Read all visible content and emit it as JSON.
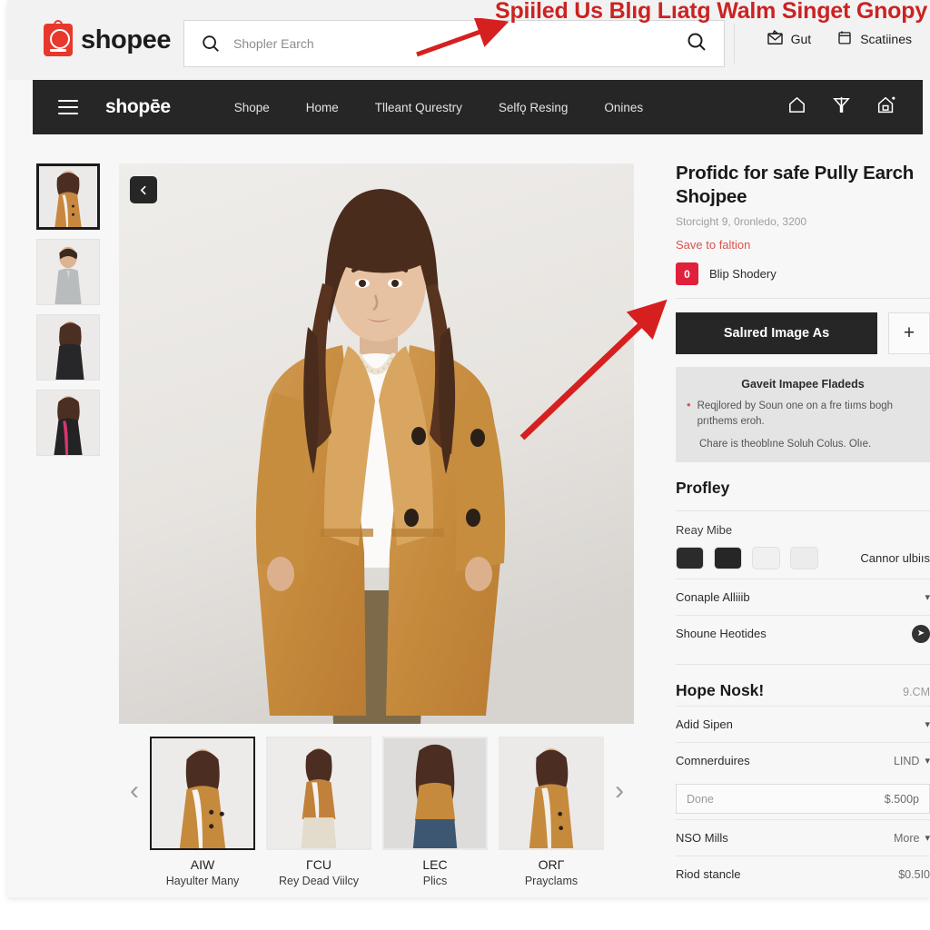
{
  "annotation": {
    "text": "Spiiled Us Blıg Lıatg Walm Singet Gnopy",
    "color": "#cc2222"
  },
  "topbar": {
    "brand": "shopee",
    "search": {
      "placeholder": "Shopler Earch",
      "value": "",
      "left_icon": "search-icon",
      "right_icon": "search-icon"
    },
    "actions": [
      {
        "label": "Gut",
        "icon": "mail-icon"
      },
      {
        "label": "Scatiines",
        "icon": "clipboard-icon"
      }
    ]
  },
  "navbar": {
    "menu_icon": "hamburger-icon",
    "logo": "shopēe",
    "links": [
      "Shope",
      "Home",
      "Tlleant Qurestry",
      "Selfǫ Resing",
      "Onines"
    ],
    "icons": [
      "home-icon",
      "funnel-icon",
      "cart-house-icon"
    ]
  },
  "gallery": {
    "prev_arrow": "chevron-left-icon",
    "thumbs": [
      {
        "alt": "tan blazer front",
        "active": true
      },
      {
        "alt": "grey sweater man",
        "active": false
      },
      {
        "alt": "black top woman",
        "active": false
      },
      {
        "alt": "black jacket pink top",
        "active": false
      }
    ]
  },
  "carousel": {
    "prev": "chevron-left-icon",
    "next": "chevron-right-icon",
    "items": [
      {
        "title": "AIW",
        "subtitle": "Hayulter Many",
        "active": true
      },
      {
        "title": "ΓCU",
        "subtitle": "Rey Dead Viilcy",
        "active": false
      },
      {
        "title": "LEC",
        "subtitle": "Plics",
        "active": false
      },
      {
        "title": "ORΓ",
        "subtitle": "Prayclams",
        "active": false
      }
    ]
  },
  "product": {
    "title": "Profidc for safe Pully Earch Shojpee",
    "subtitle": "Storcight 9, 0ronledo, 3200",
    "save_link": "Save to faltion",
    "badge_count": "0",
    "badge_label": "Blip Shodery",
    "cta_primary": "Salıred Image As",
    "cta_add": "+",
    "infobox": {
      "title": "Gaveit Imapee Fladeds",
      "bullet": "Reqjlored by Soun one on a fre tiıms bogh prıthems eroh.",
      "note": "Chare is theoblıne Soluh Colus. Olıe."
    }
  },
  "options": {
    "section_title": "Profley",
    "color_label": "Reay Mibe",
    "swatches": [
      "#2b2b2b",
      "#262626",
      "#f0f0f0",
      "#ececec"
    ],
    "swatch_note": "Cannor ulbiıs",
    "rows": [
      {
        "label": "Conaple Alliiib",
        "right": "",
        "control": "chevron-down-icon"
      },
      {
        "label": "Shoune Heotides",
        "right": "",
        "control": "circle-arrow-icon"
      }
    ]
  },
  "offer": {
    "heading": "Hope Nosk!",
    "heading_value": "9.CM",
    "rows": [
      {
        "label": "Adid Sipen",
        "right": "",
        "control": "chevron-down-icon"
      },
      {
        "label": "Comnerduires",
        "right": "LIND",
        "control": "chevron-down-icon"
      }
    ],
    "qty_placeholder": "Done",
    "qty_amount": "$.500p",
    "more_row": {
      "label": "NSO Mills",
      "right": "More",
      "control": "chevron-down-icon"
    },
    "last_row": {
      "label": "Riod stancle",
      "right": "$0.5I0"
    }
  }
}
